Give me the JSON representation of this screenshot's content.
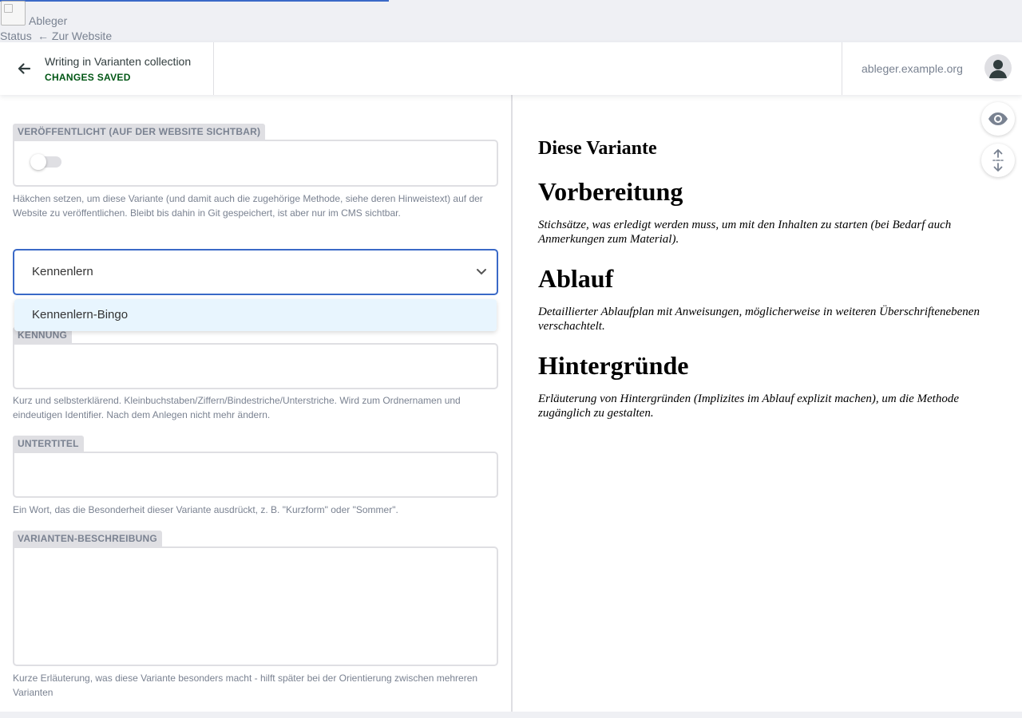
{
  "topnav": {
    "site_name": "Ableger",
    "status_link": "Status",
    "site_link": "← Zur Website"
  },
  "toolbar": {
    "title": "Writing in Varianten collection",
    "status": "CHANGES SAVED",
    "site_url": "ableger.example.org"
  },
  "editor": {
    "published": {
      "label": "VERÖFFENTLICHT (AUF DER WEBSITE SICHTBAR)",
      "checked": false,
      "hint": "Häkchen setzen, um diese Variante (und damit auch die zugehörige Methode, siehe deren Hinweistext) auf der Website zu veröffentlichen. Bleibt bis dahin in Git gespeichert, ist aber nur im CMS sichtbar."
    },
    "method_select": {
      "value": "Kennenlern",
      "options": [
        "Kennenlern-Bingo"
      ]
    },
    "kennung": {
      "label": "KENNUNG",
      "value": "",
      "hint": "Kurz und selbsterklärend. Kleinbuchstaben/Ziffern/Bindestriche/Unterstriche. Wird zum Ordnernamen und eindeutigen Identifier. Nach dem Anlegen nicht mehr ändern."
    },
    "untertitel": {
      "label": "UNTERTITEL",
      "value": "",
      "hint": "Ein Wort, das die Besonderheit dieser Variante ausdrückt, z. B. \"Kurzform\" oder \"Sommer\"."
    },
    "beschreibung": {
      "label": "VARIANTEN-BESCHREIBUNG",
      "value": "",
      "hint": "Kurze Erläuterung, was diese Variante besonders macht - hilft später bei der Orientierung zwischen mehreren Varianten"
    }
  },
  "preview": {
    "title": "Diese Variante",
    "sections": [
      {
        "heading": "Vorbereitung",
        "text": "Stichsätze, was erledigt werden muss, um mit den Inhalten zu starten (bei Bedarf auch Anmerkungen zum Material)."
      },
      {
        "heading": "Ablauf",
        "text": "Detaillierter Ablaufplan mit Anweisungen, möglicherweise in weiteren Überschriftenebenen verschachtelt."
      },
      {
        "heading": "Hintergründe",
        "text": "Erläuterung von Hintergründen (Implizites im Ablauf explizit machen), um die Methode zugänglich zu gestalten."
      }
    ]
  },
  "icons": {
    "back": "arrow-left-icon",
    "avatar": "user-icon",
    "chevron": "chevron-down-icon",
    "preview_toggle": "eye-icon",
    "sync_scroll": "scroll-sync-icon",
    "broken_image": "broken-image-icon"
  },
  "colors": {
    "accent": "#3a69c7",
    "saved_status": "#005614",
    "label_bg": "#dfdfe3",
    "option_highlight": "#e8f5fe"
  }
}
